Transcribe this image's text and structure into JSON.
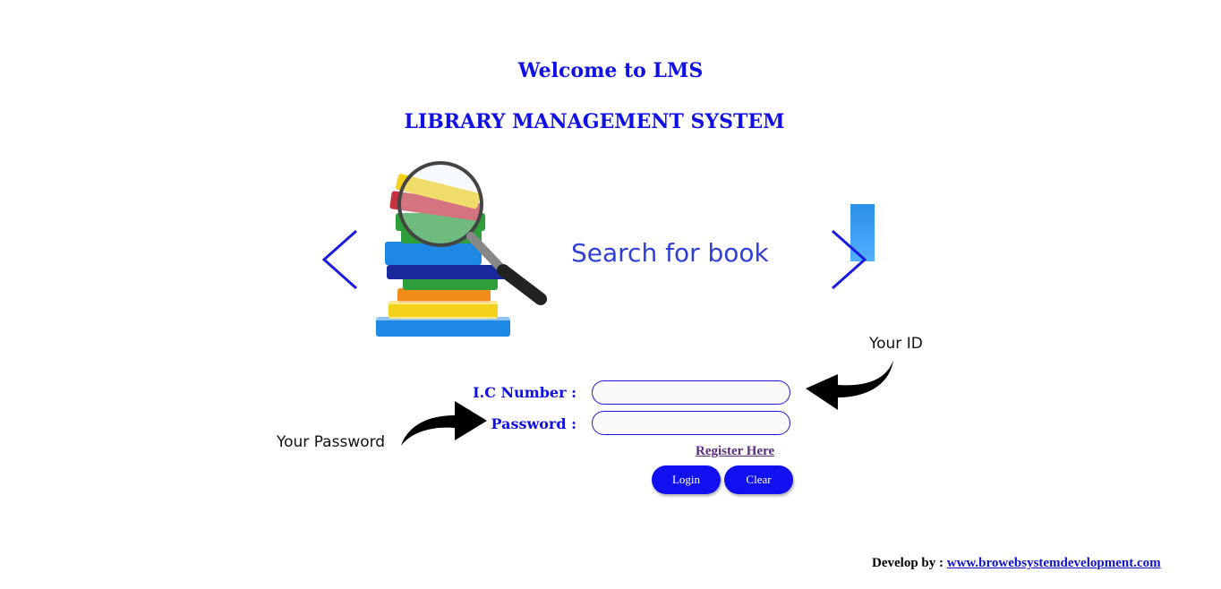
{
  "header": {
    "welcome": "Welcome to LMS",
    "system_name": "LIBRARY MANAGEMENT SYSTEM"
  },
  "carousel": {
    "slide_caption": "Search for book",
    "prev_icon": "chevron-left-icon",
    "next_icon": "chevron-right-icon"
  },
  "login_form": {
    "ic_label": "I.C Number :",
    "ic_value": "",
    "password_label": "Password :",
    "password_value": "",
    "register_link": "Register Here",
    "login_button": "Login",
    "clear_button": "Clear"
  },
  "hints": {
    "id_hint": "Your ID",
    "password_hint": "Your Password"
  },
  "footer": {
    "prefix": "Develop by :",
    "link_text": "www.browebsystemdevelopment.com"
  },
  "colors": {
    "accent": "#1010e6",
    "button": "#1010f0",
    "link_visited": "#5a2a7c"
  }
}
